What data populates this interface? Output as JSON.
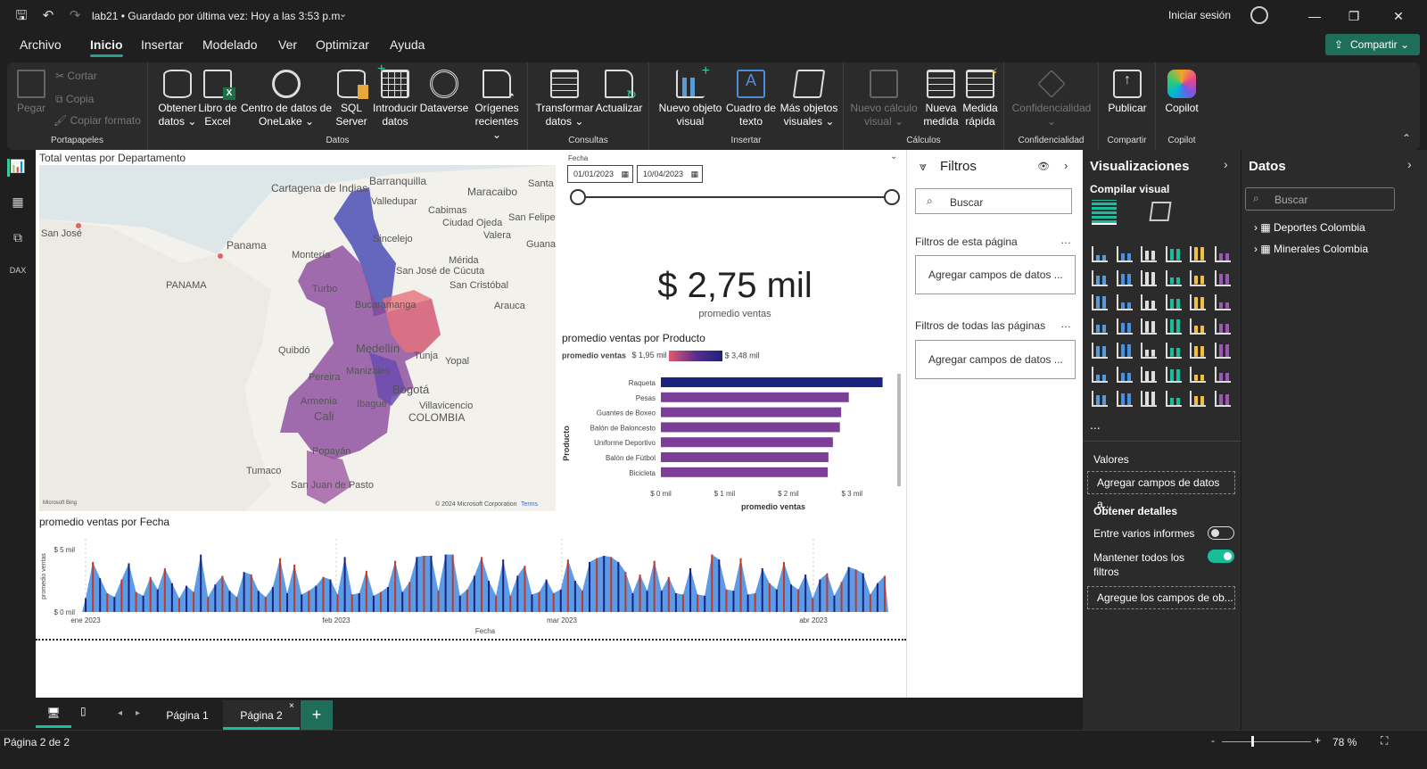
{
  "titlebar": {
    "doc_title": "lab21 • Guardado por última vez: Hoy a las 3:53 p.m.",
    "signin": "Iniciar sesión"
  },
  "menu": {
    "items": [
      "Archivo",
      "Inicio",
      "Insertar",
      "Modelado",
      "Ver",
      "Optimizar",
      "Ayuda"
    ],
    "active": "Inicio",
    "share": "Compartir"
  },
  "ribbon": {
    "clipboard": {
      "paste": "Pegar",
      "cut": "Cortar",
      "copy": "Copia",
      "format": "Copiar formato",
      "label": "Portapapeles"
    },
    "data": {
      "label": "Datos",
      "get_data": "Obtener\ndatos ⌄",
      "excel": "Libro de\nExcel",
      "onelake": "Centro de datos de\nOneLake ⌄",
      "sql": "SQL\nServer",
      "enter": "Introducir\ndatos",
      "dataverse": "Dataverse",
      "recent": "Orígenes\nrecientes ⌄"
    },
    "queries": {
      "label": "Consultas",
      "transform": "Transformar\ndatos ⌄",
      "refresh": "Actualizar"
    },
    "insert": {
      "label": "Insertar",
      "new_visual": "Nuevo objeto\nvisual",
      "textbox": "Cuadro de\ntexto",
      "more": "Más objetos\nvisuales ⌄"
    },
    "calc": {
      "label": "Cálculos",
      "new_calc": "Nuevo cálculo\nvisual ⌄",
      "new_measure": "Nueva\nmedida",
      "quick": "Medida\nrápida"
    },
    "conf": {
      "label": "Confidencialidad",
      "btn": "Confidencialidad\n⌄"
    },
    "share": {
      "label": "Compartir",
      "publish": "Publicar"
    },
    "copilot": {
      "label": "Copilot",
      "btn": "Copilot"
    }
  },
  "map": {
    "title": "Total ventas por Departamento",
    "places": [
      "Cartagena de Indias",
      "Barranquilla",
      "Maracaibo",
      "Santa Co",
      "Cabimas",
      "San Felipe",
      "Ciudad Ojeda",
      "Valledupar",
      "Valera",
      "Guanar",
      "Panama",
      "San José",
      "Sincelejo",
      "Montería",
      "PANAMA",
      "Mérida",
      "San José de Cúcuta",
      "San Cristóbal",
      "Turbo",
      "Bucaramanga",
      "Arauca",
      "Medellín",
      "Quibdó",
      "Tunja",
      "Yopal",
      "Manizales",
      "Pereira",
      "Bogotá",
      "Armenia",
      "Ibagué",
      "Villavicencio",
      "Cali",
      "COLOMBIA",
      "Popayán",
      "Tumaco",
      "San Juan de Pasto"
    ],
    "attribution": "© 2024 Microsoft Corporation",
    "terms": "Terms",
    "logo": "Microsoft Bing"
  },
  "slicer": {
    "label": "Fecha",
    "start": "01/01/2023",
    "end": "10/04/2023",
    "range": [
      0,
      1
    ]
  },
  "card": {
    "value": "$ 2,75 mil",
    "label": "promedio ventas"
  },
  "bar": {
    "title": "promedio ventas por Producto",
    "legend_label": "promedio ventas",
    "legend_min": "$ 1,95 mil",
    "legend_max": "$ 3,48 mil"
  },
  "line": {
    "title": "promedio ventas por Fecha"
  },
  "chart_data": [
    {
      "type": "bar",
      "title": "promedio ventas por Producto",
      "categories": [
        "Raqueta",
        "Pesas",
        "Guantes de Boxeo",
        "Balón de Baloncesto",
        "Uniforme Deportivo",
        "Balón de Fútbol",
        "Bicicleta"
      ],
      "values": [
        3480,
        2950,
        2830,
        2810,
        2700,
        2630,
        2620
      ],
      "xlabel": "promedio ventas",
      "ylabel": "Producto",
      "xticks": [
        "$ 0 mil",
        "$ 1 mil",
        "$ 2 mil",
        "$ 3 mil"
      ],
      "xlim": [
        0,
        3500
      ],
      "colors": {
        "high": "#1a237e",
        "low": "#7b3f98"
      }
    },
    {
      "type": "area",
      "title": "promedio ventas por Fecha",
      "xlabel": "Fecha",
      "ylabel": "promedio ventas",
      "yticks": [
        "$ 0 mil",
        "$ 5 mil"
      ],
      "ylim": [
        0,
        5000
      ],
      "xticks": [
        "ene 2023",
        "feb 2023",
        "mar 2023",
        "abr 2023"
      ],
      "x_range": [
        "2023-01-01",
        "2023-04-10"
      ],
      "values": [
        1100,
        4000,
        2700,
        1500,
        1200,
        2600,
        3900,
        1600,
        1300,
        2800,
        1800,
        3500,
        2300,
        1100,
        2100,
        1600,
        4600,
        1200,
        2200,
        2900,
        1700,
        1200,
        3200,
        3000,
        1700,
        1200,
        2000,
        4300,
        1500,
        3800,
        1400,
        1700,
        2100,
        2800,
        2600,
        1400,
        4400,
        1400,
        1500,
        3300,
        1300,
        1600,
        2000,
        4100,
        1600,
        2400,
        4400,
        4500,
        4500,
        1700,
        4600,
        4600,
        1300,
        1800,
        2900,
        4400,
        2500,
        1300,
        4200,
        1300,
        2900,
        3700,
        1400,
        1600,
        2600,
        1500,
        1800,
        4200,
        2500,
        1700,
        4000,
        4300,
        4500,
        4400,
        4000,
        3200,
        1500,
        3000,
        1700,
        4100,
        1700,
        2800,
        1500,
        1400,
        3500,
        1400,
        1300,
        4600,
        4200,
        1800,
        1700,
        4300,
        1400,
        1500,
        3500,
        2300,
        1800,
        4000,
        2200,
        1800,
        3000,
        1100,
        2600,
        3100,
        1300,
        2400,
        3600,
        3400,
        3100,
        1400,
        2300,
        2900
      ],
      "colors": {
        "bar": "#4a90e2",
        "base": "#c0392b"
      }
    }
  ],
  "filters": {
    "title": "Filtros",
    "search": "Buscar",
    "page_section": "Filtros de esta página",
    "all_section": "Filtros de todas las páginas",
    "add": "Agregar campos de datos ..."
  },
  "viz": {
    "title": "Visualizaciones",
    "build": "Compilar visual",
    "values": "Valores",
    "values_add": "Agregar campos de datos a...",
    "drill": "Obtener detalles",
    "cross_report": "Entre varios informes",
    "cross_report_toggle": "Desactivado",
    "keep_filters": "Mantener todos los\nfiltros",
    "keep_filters_toggle": "Activado",
    "drill_add": "Agregue los campos de ob...",
    "more": "..."
  },
  "data": {
    "title": "Datos",
    "search": "Buscar",
    "tables": [
      "Deportes Colombia",
      "Minerales Colombia"
    ]
  },
  "tabs": {
    "pages": [
      "Página 1",
      "Página 2"
    ],
    "active": "Página 2"
  },
  "status": {
    "page": "Página 2 de 2",
    "zoom": "78 %"
  }
}
